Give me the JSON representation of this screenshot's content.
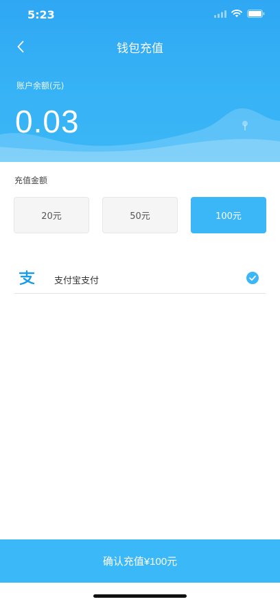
{
  "status_bar": {
    "time": "5:23"
  },
  "nav": {
    "title": "钱包充值"
  },
  "balance": {
    "label": "账户余额(元)",
    "value": "0.03"
  },
  "recharge": {
    "section_label": "充值金额",
    "options": [
      {
        "label": "20元",
        "selected": false
      },
      {
        "label": "50元",
        "selected": false
      },
      {
        "label": "100元",
        "selected": true
      }
    ]
  },
  "payment": {
    "method_label": "支付宝支付",
    "selected": true
  },
  "confirm": {
    "label": "确认充值¥100元"
  },
  "colors": {
    "accent": "#3bb6f7",
    "header": "#2fa7f3"
  },
  "icons": [
    "back-icon",
    "signal-icon",
    "wifi-icon",
    "battery-icon",
    "alipay-icon",
    "check-icon"
  ]
}
